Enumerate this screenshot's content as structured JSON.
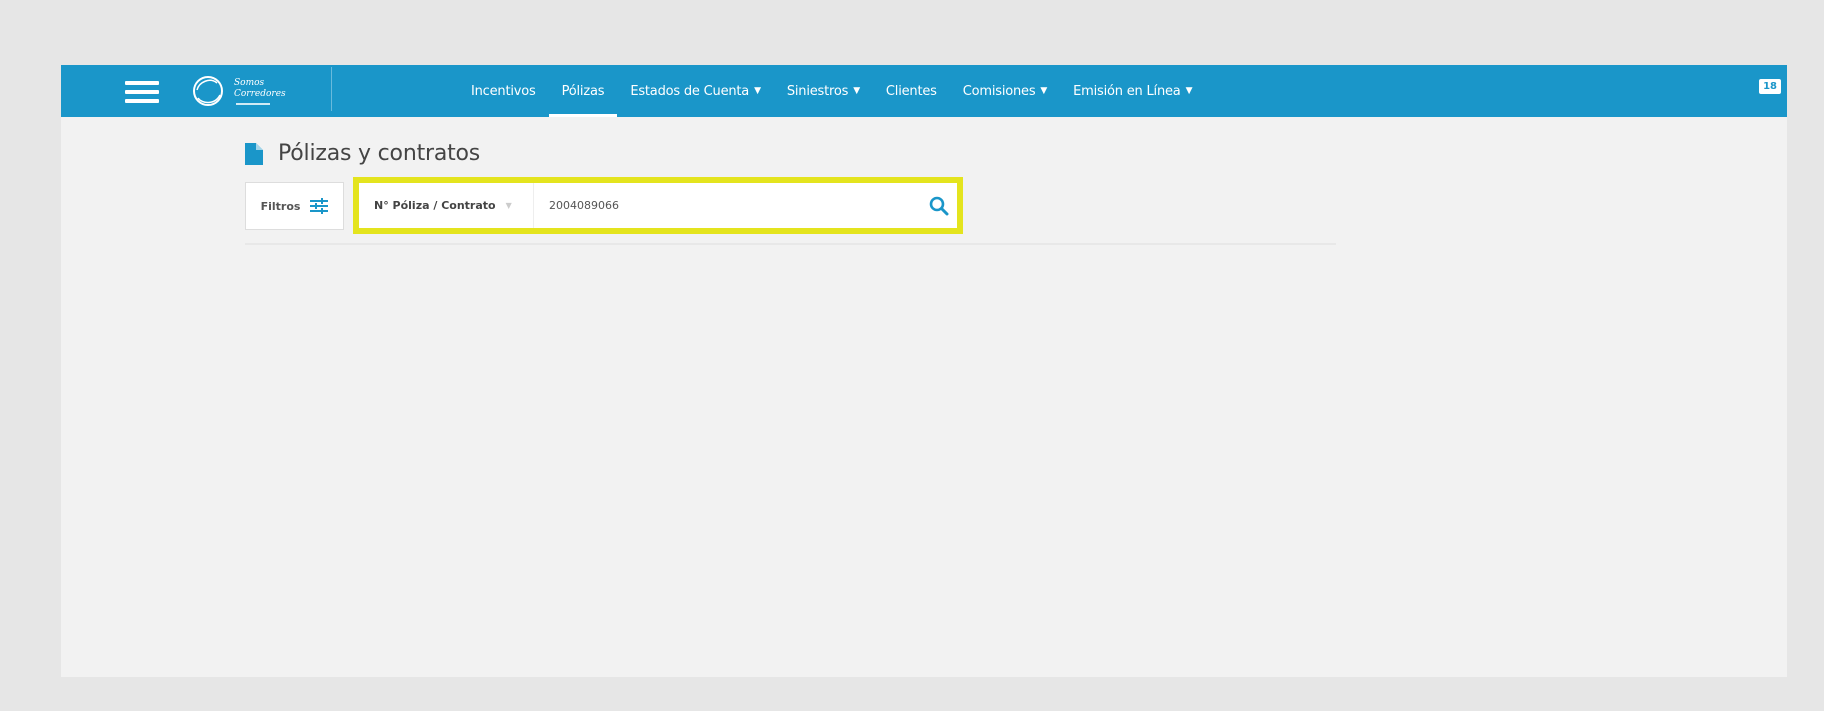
{
  "nav": {
    "items": [
      {
        "label": "Incentivos",
        "dropdown": false,
        "active": false
      },
      {
        "label": "Pólizas",
        "dropdown": false,
        "active": true
      },
      {
        "label": "Estados de Cuenta",
        "dropdown": true,
        "active": false
      },
      {
        "label": "Siniestros",
        "dropdown": true,
        "active": false
      },
      {
        "label": "Clientes",
        "dropdown": false,
        "active": false
      },
      {
        "label": "Comisiones",
        "dropdown": true,
        "active": false
      },
      {
        "label": "Emisión en Línea",
        "dropdown": true,
        "active": false
      }
    ],
    "badge": "18"
  },
  "logo": {
    "line1": "Somos",
    "line2": "Corredores"
  },
  "page": {
    "title": "Pólizas y contratos"
  },
  "filters": {
    "label": "Filtros"
  },
  "search": {
    "type_label": "N° Póliza / Contrato",
    "value": "2004089066"
  },
  "colors": {
    "brand": "#1a96c9",
    "highlight": "#e4e41e",
    "page_bg": "#f2f2f2",
    "outer_bg": "#e6e6e6"
  },
  "icons": {
    "menu": "hamburger-icon",
    "logo": "logo-circle-icon",
    "page": "document-icon",
    "filters": "sliders-icon",
    "search": "search-icon"
  }
}
